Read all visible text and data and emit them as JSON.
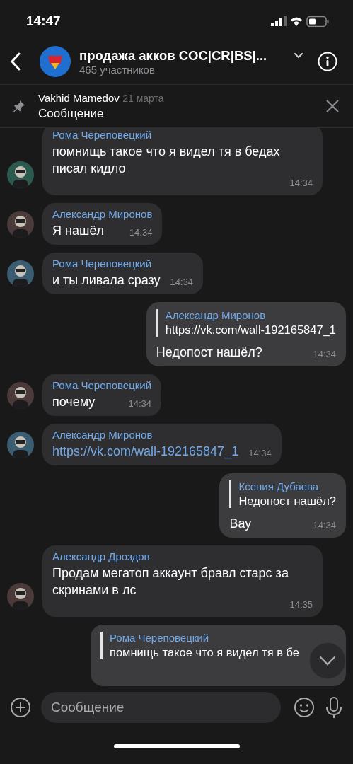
{
  "status_bar": {
    "time": "14:47"
  },
  "header": {
    "title": "продажа акков COC|CR|BS|...",
    "subtitle": "465 участников"
  },
  "pinned": {
    "author": "Vakhid Mamedov",
    "date": "21 марта",
    "text": "Сообщение"
  },
  "messages": [
    {
      "kind": "incoming",
      "sender": "Рома Череповецкий",
      "text": "помнищь такое что я видел тя в бедах писал кидло",
      "time": "14:34"
    },
    {
      "kind": "incoming",
      "sender": "Александр Миронов",
      "text": "Я нашёл",
      "time": "14:34"
    },
    {
      "kind": "incoming",
      "sender": "Рома Череповецкий",
      "text": "и ты ливала сразу",
      "time": "14:34"
    },
    {
      "kind": "outgoing",
      "reply": {
        "author": "Александр Миронов",
        "text": "https://vk.com/wall-192165847_1"
      },
      "text": "Недопост нашёл?",
      "time": "14:34"
    },
    {
      "kind": "incoming",
      "sender": "Рома Череповецкий",
      "text": "почему",
      "time": "14:34"
    },
    {
      "kind": "incoming",
      "sender": "Александр Миронов",
      "link": "https://vk.com/wall-192165847_1",
      "time": "14:34"
    },
    {
      "kind": "outgoing",
      "reply": {
        "author": "Ксения Дубаева",
        "text": "Недопост нашёл?"
      },
      "text": "Вау",
      "time": "14:34"
    },
    {
      "kind": "incoming",
      "sender": "Александр Дроздов",
      "text": "Продам мегатоп аккаунт бравл старс за скринами в лс",
      "time": "14:35"
    },
    {
      "kind": "outgoing",
      "reply": {
        "author": "Рома Череповецкий",
        "text": "помнищь такое что я видел тя в бе"
      }
    }
  ],
  "composer": {
    "placeholder": "Сообщение"
  }
}
